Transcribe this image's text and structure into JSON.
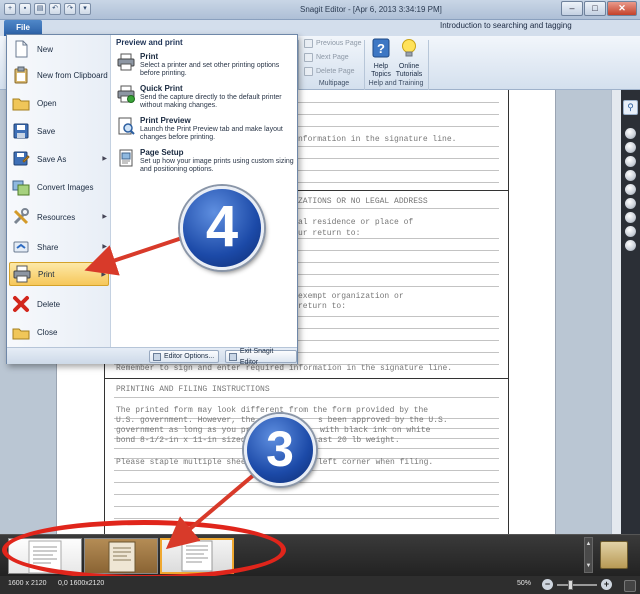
{
  "window": {
    "title": "Snagit Editor - [Apr 6, 2013 3:34:19 PM]",
    "document_title": "Introduction to searching and tagging",
    "minimize": "–",
    "maximize": "□",
    "close": "✕"
  },
  "quick_access": {
    "new_symbol": "+",
    "save_symbol": "▪",
    "print_symbol": "▤",
    "undo_symbol": "↶",
    "redo_symbol": "↷",
    "more_symbol": "▾"
  },
  "ribbon": {
    "file_tab": "File",
    "multipage": {
      "previous_page": "Previous Page",
      "next_page": "Next Page",
      "delete_page": "Delete Page",
      "group_label": "Multipage"
    },
    "help_training": {
      "help_topics": [
        "Help",
        "Topics"
      ],
      "online_tutorials": [
        "Online",
        "Tutorials"
      ],
      "group_label": "Help and Training"
    }
  },
  "file_menu": {
    "items": [
      {
        "label": "New",
        "icon": "new-document-icon"
      },
      {
        "label": "New from Clipboard",
        "icon": "clipboard-icon"
      },
      {
        "label": "Open",
        "icon": "open-folder-icon"
      },
      {
        "label": "Save",
        "icon": "save-disk-icon"
      },
      {
        "label": "Save As",
        "icon": "save-as-icon"
      },
      {
        "label": "Convert Images",
        "icon": "convert-images-icon"
      },
      {
        "label": "Resources",
        "icon": "resources-tools-icon"
      },
      {
        "label": "Share",
        "icon": "share-icon"
      },
      {
        "label": "Print",
        "icon": "printer-icon"
      },
      {
        "label": "Delete",
        "icon": "delete-x-icon"
      },
      {
        "label": "Close",
        "icon": "close-folder-icon"
      }
    ],
    "panel_header": "Preview and print",
    "panel_items": [
      {
        "title": "Print",
        "desc": "Select a printer and set other printing options before printing.",
        "icon": "printer-icon"
      },
      {
        "title": "Quick Print",
        "desc": "Send the capture directly to the default printer without making changes.",
        "icon": "quick-print-icon"
      },
      {
        "title": "Print Preview",
        "desc": "Launch the Print Preview tab and make layout changes before printing.",
        "icon": "print-preview-icon"
      },
      {
        "title": "Page Setup",
        "desc": "Set up how your image prints using custom sizing and positioning options.",
        "icon": "page-setup-icon"
      }
    ],
    "editor_options": "Editor Options...",
    "exit": "Exit Snagit Editor"
  },
  "document_text": {
    "line1": "nformation in the signature line.",
    "line2": "ZATIONS OR NO LEGAL ADDRESS",
    "line3": "al residence or place of",
    "line4": "ur return to:",
    "line5": "exempt organization or",
    "line6": "return to:",
    "line7": "Remember to sign and enter required information in the signature line.",
    "heading": "PRINTING AND FILING INSTRUCTIONS",
    "para1": "The printed form may look different from the form provided by the",
    "para2a": "U.S. government. However, the",
    "para2b": "s been approved by the U.S.",
    "para3a": "government as long as you pr",
    "para3b": "with black ink on white",
    "para4a": "bond 8-1/2-in x 11-in sized",
    "para4b": "ast 20 lb weight.",
    "para5a": "Please staple multiple shee",
    "para5b": "left corner when filing."
  },
  "callouts": {
    "step_four": "4",
    "step_three": "3"
  },
  "colors": {
    "callout_blue": "#1c4aa8",
    "highlight_red": "#e0251b",
    "arrow_red": "#d83a2a",
    "active_item": "#f6c75a"
  },
  "status_bar": {
    "dimensions": "1600 x 2120",
    "position": "0,0  1600x2120",
    "zoom": "50%",
    "zoom_out": "−",
    "zoom_in": "+"
  },
  "palette_search_symbol": "⚲",
  "tray_scroll": {
    "up": "▲",
    "down": "▼"
  }
}
